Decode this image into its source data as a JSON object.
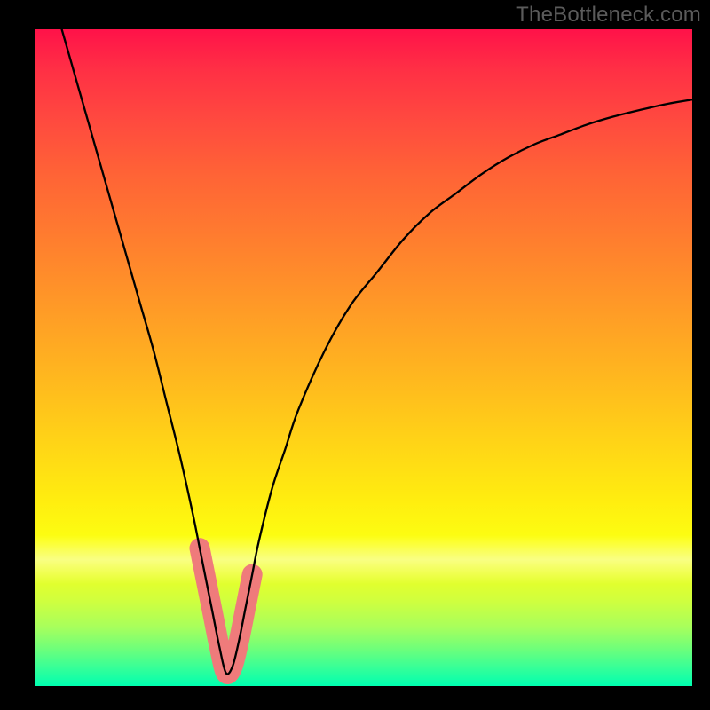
{
  "watermark": "TheBottleneck.com",
  "chart_data": {
    "type": "line",
    "title": "",
    "xlabel": "",
    "ylabel": "",
    "xlim": [
      0,
      100
    ],
    "ylim": [
      0,
      100
    ],
    "grid": false,
    "legend": "none",
    "background_gradient": {
      "stops": [
        {
          "pos": 0.0,
          "color": "#ff1249"
        },
        {
          "pos": 0.5,
          "color": "#ffbd1d"
        },
        {
          "pos": 0.8,
          "color": "#fcff12"
        },
        {
          "pos": 1.0,
          "color": "#00ffb0"
        }
      ]
    },
    "minimum_x": 29,
    "series": [
      {
        "name": "main-curve",
        "stroke": "#000000",
        "stroke_width": 2,
        "x": [
          4,
          6,
          8,
          10,
          12,
          14,
          16,
          18,
          20,
          22,
          24,
          25,
          26,
          27,
          28,
          29,
          30,
          31,
          32,
          33,
          34,
          36,
          38,
          40,
          44,
          48,
          52,
          56,
          60,
          64,
          68,
          72,
          76,
          80,
          84,
          88,
          92,
          96,
          100
        ],
        "y": [
          100,
          93,
          86,
          79,
          72,
          65,
          58,
          51,
          43,
          35,
          26,
          21,
          16,
          11,
          6,
          2,
          3,
          7,
          12,
          17,
          22,
          30,
          36,
          42,
          51,
          58,
          63,
          68,
          72,
          75,
          78,
          80.5,
          82.5,
          84,
          85.5,
          86.7,
          87.7,
          88.6,
          89.3
        ]
      },
      {
        "name": "highlight-near-minimum",
        "stroke": "#ef7b7b",
        "stroke_width": 14,
        "x": [
          25,
          26,
          27,
          28,
          29,
          30,
          31,
          32,
          33
        ],
        "y": [
          21,
          16,
          11,
          6,
          2,
          3,
          7,
          12,
          17
        ]
      }
    ]
  }
}
